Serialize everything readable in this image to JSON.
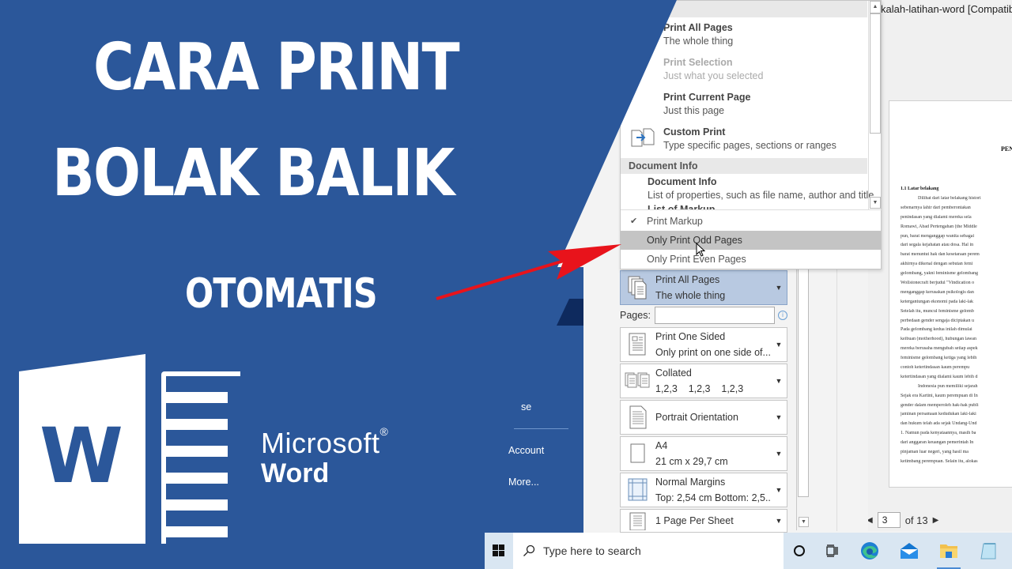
{
  "thumbnail": {
    "title_line1": "CARA PRINT",
    "title_line2": "BOLAK BALIK",
    "title_line3": "OTOMATIS",
    "brand_microsoft": "Microsoft",
    "brand_registered": "®",
    "brand_word": "Word",
    "logo_letter": "W",
    "colors": {
      "blue": "#2b579a",
      "dark_blue": "#0e2a5e",
      "arrow_red": "#e8131b"
    }
  },
  "backstage_nav": {
    "partial_item": "se",
    "items": [
      {
        "label": "Account"
      },
      {
        "label": "More..."
      }
    ]
  },
  "document": {
    "title": "kalah-latihan-word [Compatibil",
    "heading": "PEN",
    "subheading": "1.1 Latar belakang",
    "lines": [
      {
        "text": "Dilihat dari latar belakang histori",
        "indent": true
      },
      {
        "text": "sebenarnya lahir dari pemberontakan",
        "indent": false
      },
      {
        "text": "penindasan yang dialami mereka sela",
        "indent": false
      },
      {
        "text": "Romawi, Abad Pertengahan (the Middle",
        "indent": false
      },
      {
        "text": "pun, barat menganggap wanita sebagai",
        "indent": false
      },
      {
        "text": "dari segala kejahatan atau dosa. Hal in",
        "indent": false
      },
      {
        "text": "barat menuntut hak dan kesetaraan perem",
        "indent": false
      },
      {
        "text": "akhirnya dikenal dengan sebutan femi",
        "indent": false
      },
      {
        "text": "gelombang, yakni feminisme gelombang",
        "indent": false
      },
      {
        "text": "Wollstonecraft berjudul \"Vindication o",
        "indent": false
      },
      {
        "text": "menganggap kerusakan psikologis dan",
        "indent": false
      },
      {
        "text": "ketergantungan ekonomi pada laki-lak",
        "indent": false
      },
      {
        "text": "Setelah itu, muncul feminisme gelomb",
        "indent": false
      },
      {
        "text": "perbedaan gender sengaja diciptakan u",
        "indent": false
      },
      {
        "text": "Pada gelombang kedua inilah dimulai",
        "indent": false
      },
      {
        "text": "keibuan (motherhood), hubungan lawan",
        "indent": false
      },
      {
        "text": "mereka berusaha mengubah setiap aspek",
        "indent": false
      },
      {
        "text": "feminisme gelombang ketiga yang lebih",
        "indent": false
      },
      {
        "text": "contoh ketertindasan kaum perempu",
        "indent": false
      },
      {
        "text": "ketertindasan yang dialami kaum lebih d",
        "indent": false
      },
      {
        "text": "Indonesia pun memiliki sejarah",
        "indent": true
      },
      {
        "text": "Sejak era Kartini, kaum perempuan di In",
        "indent": false
      },
      {
        "text": "gender dalam memperoleh hak-hak publi",
        "indent": false
      },
      {
        "text": "jaminan persamaan kedudukan laki-laki",
        "indent": false
      },
      {
        "text": "dan hukum telah ada sejak Undang-Und",
        "indent": false
      },
      {
        "text": "1. Namun pada kenyataannya, masih ba",
        "indent": false
      },
      {
        "text": "dari anggaran keuangan pemerintah In",
        "indent": false
      },
      {
        "text": "pinjaman luar negeri, yang hasil ma",
        "indent": false
      },
      {
        "text": "ketimbang perempuan. Selain itu, alokas",
        "indent": false
      }
    ],
    "current_page": "3",
    "page_total_label": "of 13"
  },
  "print_range_dropdown": {
    "items": [
      {
        "title": "Print All Pages",
        "subtitle": "The whole thing",
        "enabled": true
      },
      {
        "title": "Print Selection",
        "subtitle": "Just what you selected",
        "enabled": false
      },
      {
        "title": "Print Current Page",
        "subtitle": "Just this page",
        "enabled": true
      },
      {
        "title": "Custom Print",
        "subtitle": "Type specific pages, sections or ranges",
        "enabled": true
      }
    ],
    "section_header": "Document Info",
    "doc_info": {
      "title": "Document Info",
      "subtitle": "List of properties, such as file name, author and title",
      "cut_off_next": "List of Markup"
    },
    "toggles": [
      {
        "label": "Print Markup",
        "checked": true,
        "hovered": false
      },
      {
        "label": "Only Print Odd Pages",
        "checked": false,
        "hovered": true
      },
      {
        "label": "Only Print Even Pages",
        "checked": false,
        "hovered": false
      }
    ]
  },
  "print_settings": {
    "range": {
      "title": "Print All Pages",
      "subtitle": "The whole thing"
    },
    "pages_label": "Pages:",
    "pages_value": "",
    "sides": {
      "title": "Print One Sided",
      "subtitle": "Only print on one side of..."
    },
    "collation": {
      "title": "Collated",
      "subtitle": "1,2,3    1,2,3    1,2,3"
    },
    "orientation": {
      "title": "Portrait Orientation"
    },
    "paper": {
      "title": "A4",
      "subtitle": "21 cm x 29,7 cm"
    },
    "margins": {
      "title": "Normal Margins",
      "subtitle": "Top: 2,54 cm Bottom: 2,5..."
    },
    "per_sheet": {
      "title": "1 Page Per Sheet"
    }
  },
  "taskbar": {
    "search_placeholder": "Type here to search",
    "icons": [
      "cortana",
      "task-view",
      "edge",
      "mail",
      "file-explorer",
      "notepad"
    ]
  }
}
